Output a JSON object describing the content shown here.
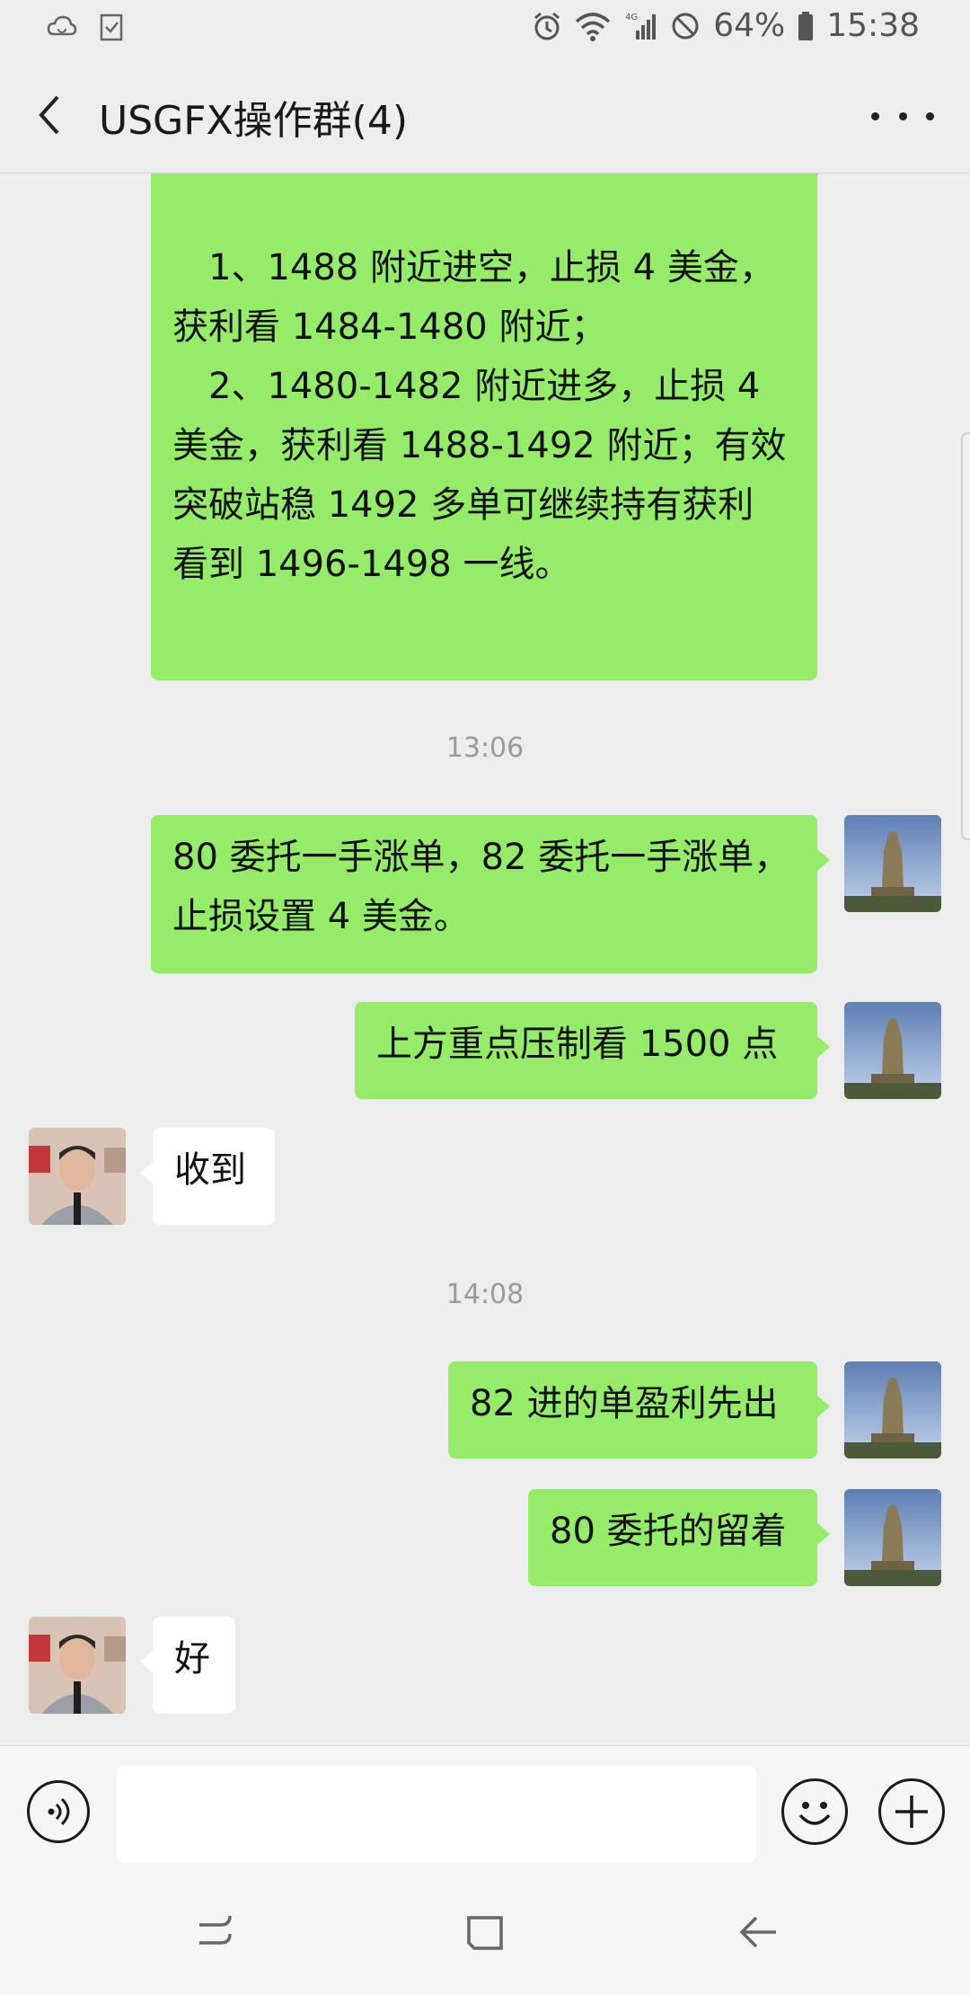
{
  "status_bar": {
    "battery": "64%",
    "time": "15:38",
    "network": "4G"
  },
  "header": {
    "title": "USGFX操作群(4)"
  },
  "messages": {
    "m1": {
      "lines": [
        "",
        "",
        "　1、1488 附近进空，止损 4 美金，",
        "获利看 1484-1480 附近；",
        "　2、1480-1482 附近进多，止损 4",
        "美金，获利看 1488-1492 附近；有效",
        "突破站稳 1492 多单可继续持有获利",
        "看到 1496-1498 一线。"
      ]
    },
    "t1": "13:06",
    "m2": {
      "lines": [
        "80 委托一手涨单，82 委托一手涨单，",
        "止损设置 4 美金。"
      ]
    },
    "m3": "上方重点压制看 1500 点",
    "m4": "收到",
    "t2": "14:08",
    "m5": "82 进的单盈利先出",
    "m6": "80 委托的留着",
    "m7": "好"
  },
  "input": {
    "value": ""
  },
  "colors": {
    "background": "#ededed",
    "my_bubble": "#95ec69",
    "their_bubble": "#ffffff"
  },
  "icons": [
    "cloud-sync-icon",
    "clipboard-check-icon",
    "alarm-icon",
    "wifi-icon",
    "signal-icon",
    "dnd-icon",
    "battery-icon",
    "back-icon",
    "more-icon",
    "voice-icon",
    "emoji-icon",
    "plus-icon",
    "recent-apps-icon",
    "home-icon",
    "back-nav-icon"
  ]
}
